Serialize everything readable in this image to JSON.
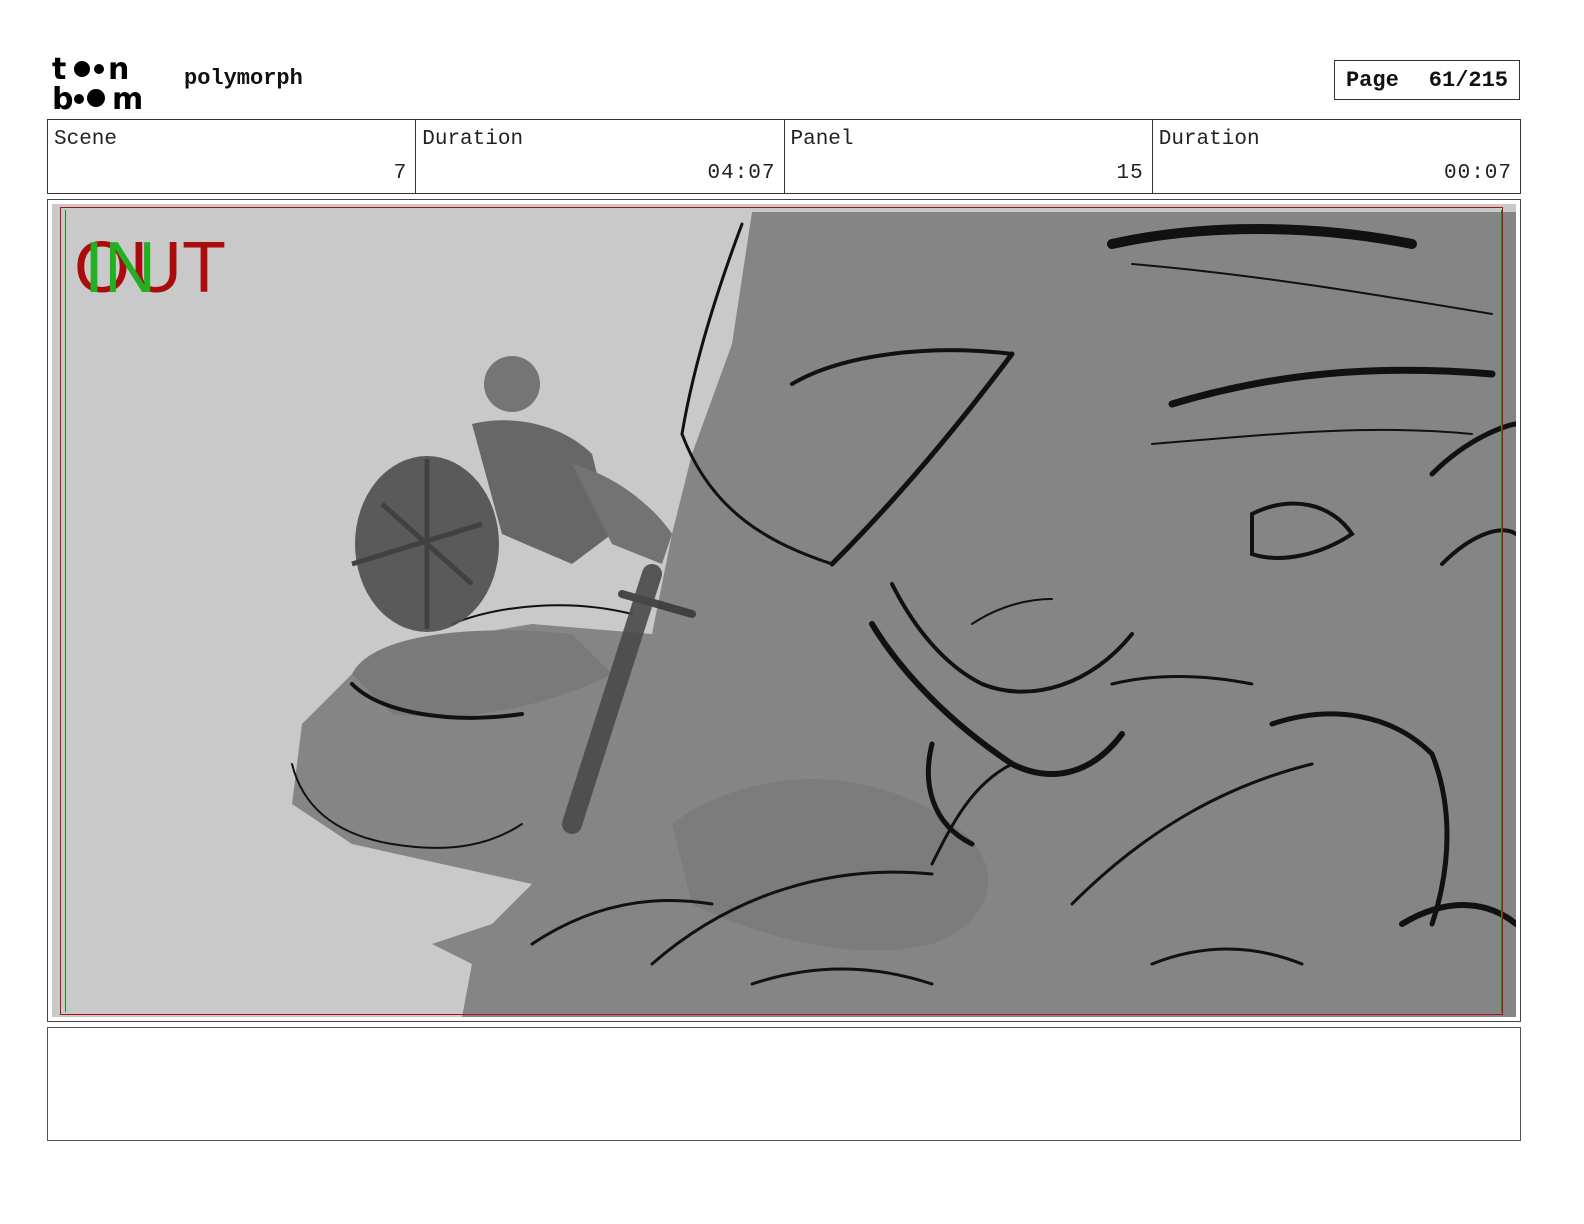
{
  "header": {
    "logo_text": "toon boom",
    "project_title": "polymorph",
    "page_label": "Page",
    "page_value": "61/215"
  },
  "info": {
    "scene_label": "Scene",
    "scene_value": "7",
    "scene_duration_label": "Duration",
    "scene_duration_value": "04:07",
    "panel_label": "Panel",
    "panel_value": "15",
    "panel_duration_label": "Duration",
    "panel_duration_value": "00:07"
  },
  "panel": {
    "marker_out": "OUT",
    "marker_in": "IN",
    "art_description_icon": "storyboard-sketch-warrior-on-creature"
  },
  "notes": {
    "text": ""
  },
  "colors": {
    "safe_frame_red": "#b01010",
    "safe_frame_green": "#1a8a1a",
    "marker_out": "#aa0c0c",
    "marker_in": "#22b022"
  }
}
